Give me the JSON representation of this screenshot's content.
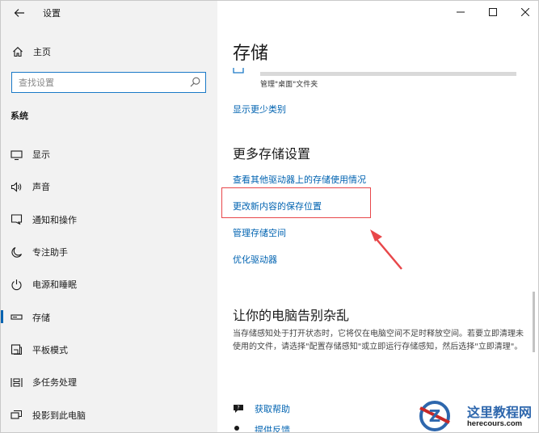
{
  "window": {
    "title": "设置",
    "controls": {
      "minimize_icon": "minimize-icon",
      "maximize_icon": "maximize-icon",
      "close_icon": "close-icon"
    }
  },
  "sidebar": {
    "back_icon": "back-arrow-icon",
    "home_label": "主页",
    "search_placeholder": "查找设置",
    "section_label": "系统",
    "items": [
      {
        "label": "显示",
        "icon": "monitor-icon",
        "selected": false
      },
      {
        "label": "声音",
        "icon": "speaker-icon",
        "selected": false
      },
      {
        "label": "通知和操作",
        "icon": "notification-icon",
        "selected": false
      },
      {
        "label": "专注助手",
        "icon": "moon-icon",
        "selected": false
      },
      {
        "label": "电源和睡眠",
        "icon": "power-icon",
        "selected": false
      },
      {
        "label": "存储",
        "icon": "storage-icon",
        "selected": true
      },
      {
        "label": "平板模式",
        "icon": "tablet-icon",
        "selected": false
      },
      {
        "label": "多任务处理",
        "icon": "multitask-icon",
        "selected": false
      },
      {
        "label": "投影到此电脑",
        "icon": "project-icon",
        "selected": false
      }
    ]
  },
  "main": {
    "page_title": "存储",
    "usage_label": "管理\"桌面\"文件夹",
    "show_less_link": "显示更少类别",
    "more_settings_title": "更多存储设置",
    "links": [
      "查看其他驱动器上的存储使用情况",
      "更改新内容的保存位置",
      "管理存储空间",
      "优化驱动器"
    ],
    "declutter_title": "让你的电脑告别杂乱",
    "declutter_body": "当存储感知处于打开状态时，它将仅在电脑空间不足时释放空间。若要立即清理未使用的文件，请选择\"配置存储感知\"或立即运行存储感知，然后选择\"立即清理\"。",
    "help": [
      {
        "label": "获取帮助",
        "icon": "help-chat-icon"
      },
      {
        "label": "提供反馈",
        "icon": "feedback-icon"
      }
    ]
  },
  "annotation": {
    "highlight_color": "#e8474a",
    "accent": "#0063b1"
  },
  "watermark": {
    "name": "这里教程网",
    "url": "herecours.com"
  }
}
